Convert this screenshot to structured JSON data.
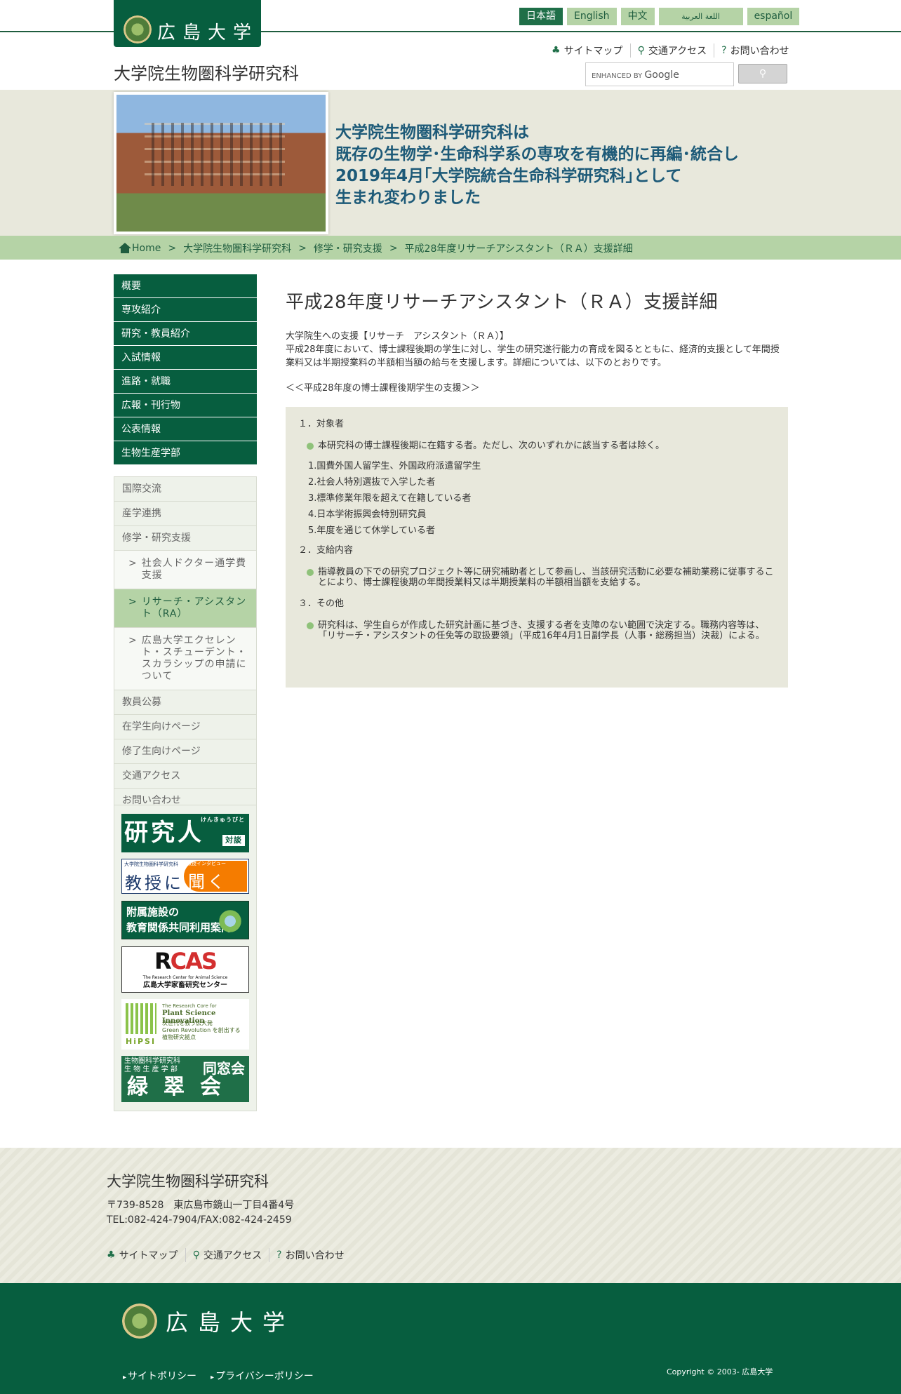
{
  "header": {
    "logo_text": "広島大学",
    "site_title": "大学院生物圏科学研究科",
    "languages": [
      "日本語",
      "English",
      "中文",
      "اللغة العربية",
      "español"
    ],
    "util_links": [
      "サイトマップ",
      "交通アクセス",
      "お問い合わせ"
    ],
    "search_placeholder": "ENHANCED BY Google",
    "search_prefix": "ENHANCED BY",
    "search_brand": "Google"
  },
  "banner": {
    "lines": [
      "大学院生物圏科学研究科は",
      "既存の生物学･生命科学系の専攻を有機的に再編･統合し",
      "2019年4月｢大学院統合生命科学研究科｣として",
      "生まれ変わりました"
    ]
  },
  "breadcrumb": [
    "Home",
    ">",
    "大学院生物圏科学研究科",
    ">",
    "修学・研究支援",
    ">",
    "平成28年度リサーチアシスタント（ＲＡ）支援詳細"
  ],
  "sidebar": {
    "main": [
      "概要",
      "専攻紹介",
      "研究・教員紹介",
      "入試情報",
      "進路・就職",
      "広報・刊行物",
      "公表情報",
      "生物生産学部"
    ],
    "sub_before": [
      "国際交流",
      "産学連携",
      "修学・研究支援"
    ],
    "children": [
      {
        "label": "社会人ドクター通学費支援",
        "active": false
      },
      {
        "label": "リサーチ・アシスタント（RA）",
        "active": true
      },
      {
        "label": "広島大学エクセレント・スチューデント・スカラシップの申請について",
        "active": false
      }
    ],
    "sub_after": [
      "教員公募",
      "在学生向けページ",
      "修了生向けページ",
      "交通アクセス",
      "お問い合わせ"
    ]
  },
  "side_banners": {
    "b1_main": "研究人",
    "b1_ruby": "けんきゅうびと",
    "b1_tag": "対談",
    "b2_top": "大学院生物圏科学研究科",
    "b2_tag": "教授インタビュー",
    "b2_left": "教授に",
    "b2_right": "聞く",
    "b3_line1": "附属施設の",
    "b3_line2": "教育関係共同利用案内",
    "b4_logo_a": "R",
    "b4_logo_b": "CAS",
    "b4_small": "The Research Center for Animal Science",
    "b4_caption": "広島大学家畜研究センター",
    "b5_brand": "HiPSI",
    "b5_t1": "The Research Core for",
    "b5_t2": "Plant Science Innovation",
    "b5_t3a": "次世代を救う広大発",
    "b5_t3b": "Green Revolution を創出する",
    "b5_t3c": "植物研究拠点",
    "b6_small_a": "生物圏科学研究科",
    "b6_small_b": "生 物 生 産 学 部",
    "b6_tag": "同窓会",
    "b6_main": "緑翠会"
  },
  "main": {
    "title": "平成28年度リサーチアシスタント（ＲＡ）支援詳細",
    "intro_heading": "大学院生への支援【リサーチ　アシスタント（ＲＡ）】",
    "intro_body": "平成28年度において、博士課程後期の学生に対し、学生の研究遂行能力の育成を図るとともに、経済的支援として年間授業料又は半期授業料の半額相当額の給与を支援します。詳細については、以下のとおりです。",
    "sub_heading": "＜＜平成28年度の博士課程後期学生の支援＞＞",
    "sections": [
      {
        "heading": "１．対象者",
        "bullet": "本研究科の博士課程後期に在籍する者。ただし、次のいずれかに該当する者は除く。",
        "list": [
          "1.国費外国人留学生、外国政府派遣留学生",
          "2.社会人特別選抜で入学した者",
          "3.標準修業年限を超えて在籍している者",
          "4.日本学術振興会特別研究員",
          "5.年度を通じて休学している者"
        ]
      },
      {
        "heading": "２．支給内容",
        "bullet": "指導教員の下での研究プロジェクト等に研究補助者として参画し、当該研究活動に必要な補助業務に従事することにより、博士課程後期の年間授業料又は半期授業料の半額相当額を支給する。"
      },
      {
        "heading": "３．その他",
        "bullet": "研究科は、学生自らが作成した研究計画に基づき、支援する者を支障のない範囲で決定する。職務内容等は、「リサーチ・アシスタントの任免等の取扱要領」（平成16年4月1日副学長（人事・総務担当）決裁）による。"
      }
    ]
  },
  "footer": {
    "title": "大学院生物圏科学研究科",
    "address": "〒739-8528　東広島市鏡山一丁目4番4号",
    "tel": "TEL:082-424-7904/FAX:082-424-2459",
    "util_links": [
      "サイトマップ",
      "交通アクセス",
      "お問い合わせ"
    ],
    "logo_text": "広島大学",
    "links": [
      "サイトポリシー",
      "プライバシーポリシー"
    ],
    "copyright": "Copyright © 2003- 広島大学"
  },
  "colors": {
    "brand_green": "#075e3f",
    "light_green": "#b5d3a6",
    "banner_text": "#1d5a78",
    "beige": "#e8e8dc"
  },
  "icons": [
    "sitemap-icon",
    "map-pin-icon",
    "question-icon",
    "home-icon",
    "search-icon"
  ]
}
